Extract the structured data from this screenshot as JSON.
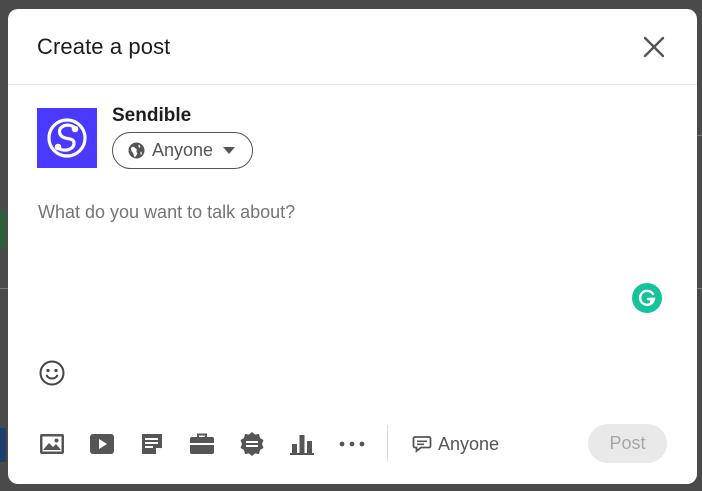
{
  "modal": {
    "title": "Create a post"
  },
  "author": {
    "name": "Sendible",
    "visibility": "Anyone"
  },
  "composer": {
    "placeholder": "What do you want to talk about?"
  },
  "toolbar": {
    "icons": [
      "photo-icon",
      "video-icon",
      "document-icon",
      "job-icon",
      "celebrate-icon",
      "poll-icon",
      "more-icon"
    ]
  },
  "comments": {
    "visibility": "Anyone"
  },
  "actions": {
    "post_label": "Post"
  },
  "colors": {
    "brand": "#4a3aff",
    "grammarly": "#15c39a",
    "post_disabled_bg": "#e9e9e9",
    "post_disabled_text": "#a7a7a7"
  }
}
